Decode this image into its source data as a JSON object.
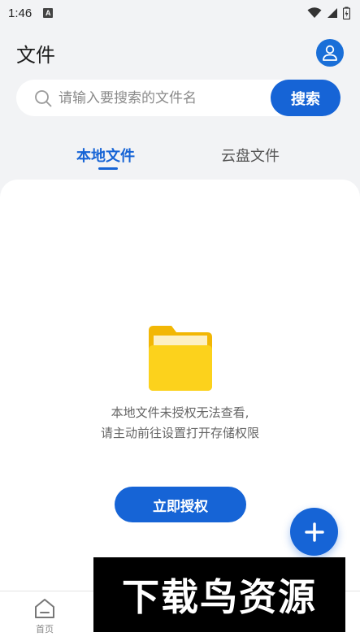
{
  "status_bar": {
    "time": "1:46",
    "notification_glyph": "A"
  },
  "header": {
    "title": "文件",
    "profile_icon": "user-icon"
  },
  "search": {
    "placeholder": "请输入要搜索的文件名",
    "button_label": "搜索"
  },
  "tabs": [
    {
      "label": "本地文件",
      "active": true
    },
    {
      "label": "云盘文件",
      "active": false
    }
  ],
  "empty_state": {
    "icon": "folder-icon",
    "message_line1": "本地文件未授权无法查看,",
    "message_line2": "请主动前往设置打开存储权限",
    "action_label": "立即授权"
  },
  "fab": {
    "icon": "plus-icon"
  },
  "bottom_nav": {
    "items": [
      {
        "label": "首页",
        "icon": "home-icon"
      }
    ]
  },
  "watermark": {
    "text": "下载鸟资源"
  },
  "colors": {
    "accent": "#1664d6",
    "background": "#f2f3f5",
    "folder": "#f7c815"
  }
}
